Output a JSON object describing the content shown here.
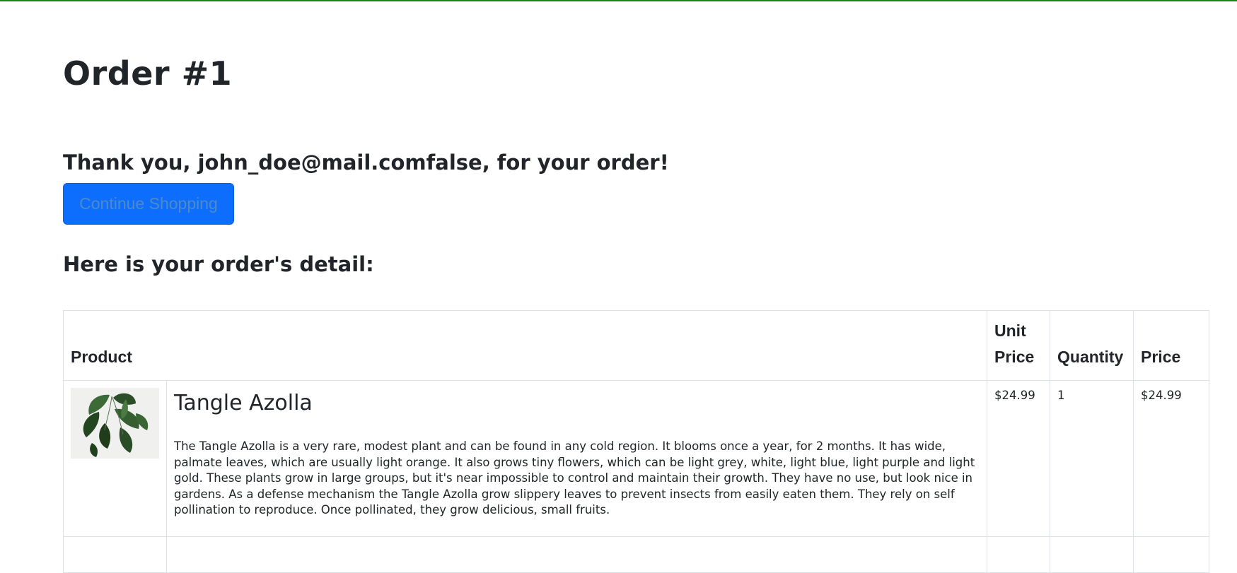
{
  "page": {
    "title": "Order #1",
    "thanks": "Thank you, john_doe@mail.comfalse, for your order!",
    "continue_label": "Continue Shopping",
    "detail_heading": "Here is your order's detail:"
  },
  "table": {
    "headers": {
      "product": "Product",
      "unit_price": "Unit Price",
      "quantity": "Quantity",
      "price": "Price"
    },
    "rows": [
      {
        "image": "plant-photo",
        "name": "Tangle Azolla",
        "description": "The Tangle Azolla is a very rare, modest plant and can be found in any cold region. It blooms once a year, for 2 months. It has wide, palmate leaves, which are usually light orange. It also grows tiny flowers, which can be light grey, white, light blue, light purple and light gold. These plants grow in large groups, but it's near impossible to control and maintain their growth. They have no use, but look nice in gardens. As a defense mechanism the Tangle Azolla grow slippery leaves to prevent insects from easily eaten them. They rely on self pollination to reproduce. Once pollinated, they grow delicious, small fruits.",
        "unit_price": "$24.99",
        "quantity": "1",
        "price": "$24.99"
      }
    ]
  },
  "colors": {
    "top_border": "#138a0e",
    "primary": "#0d6efd"
  }
}
